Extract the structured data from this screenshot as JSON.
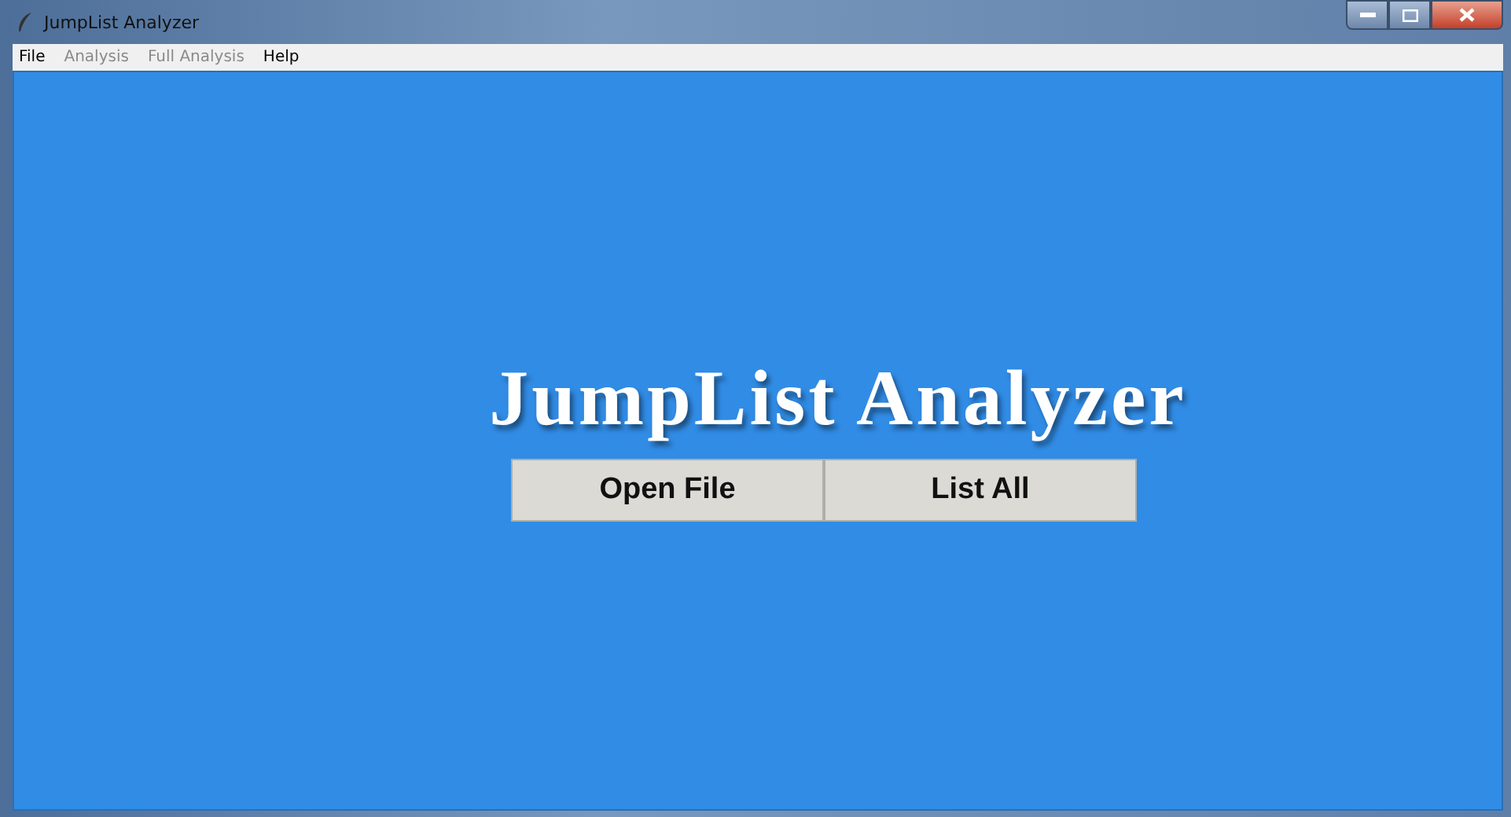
{
  "window": {
    "title": "JumpList Analyzer"
  },
  "menu": [
    {
      "label": "File",
      "disabled": false
    },
    {
      "label": "Analysis",
      "disabled": true
    },
    {
      "label": "Full Analysis",
      "disabled": true
    },
    {
      "label": "Help",
      "disabled": false
    }
  ],
  "heading": "JumpList Analyzer",
  "buttons": [
    "Open File",
    "List All"
  ]
}
